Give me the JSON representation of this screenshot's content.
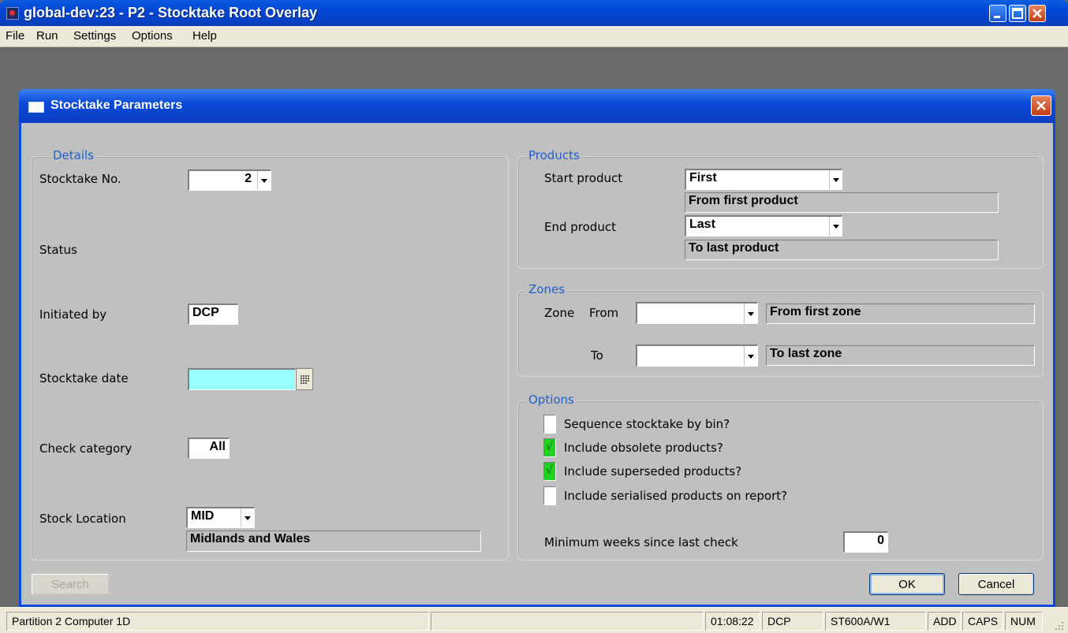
{
  "window": {
    "title": "global-dev:23 - P2 - Stocktake Root Overlay"
  },
  "menu": [
    "File",
    "Run",
    "Settings",
    "Options",
    "Help"
  ],
  "dialog": {
    "title": "Stocktake Parameters"
  },
  "details": {
    "group_title": "Details",
    "stocktake_no_label": "Stocktake No.",
    "stocktake_no_value": "2",
    "status_label": "Status",
    "initiated_by_label": "Initiated by",
    "initiated_by_value": "DCP",
    "stocktake_date_label": "Stocktake date",
    "stocktake_date_value": "",
    "check_category_label": "Check category",
    "check_category_value": "All",
    "stock_location_label": "Stock Location",
    "stock_location_value": "MID",
    "stock_location_desc": "Midlands and Wales"
  },
  "products": {
    "group_title": "Products",
    "start_label": "Start product",
    "start_value": "First",
    "start_desc": "From first product",
    "end_label": "End product",
    "end_value": "Last",
    "end_desc": "To last product"
  },
  "zones": {
    "group_title": "Zones",
    "zone_label": "Zone",
    "from_label": "From",
    "from_value": "",
    "from_desc": "From first zone",
    "to_label": "To",
    "to_value": "",
    "to_desc": "To last zone"
  },
  "options": {
    "group_title": "Options",
    "items": [
      {
        "label": "Sequence stocktake by bin?",
        "checked": false
      },
      {
        "label": "Include obsolete products?",
        "checked": true
      },
      {
        "label": "Include superseded products?",
        "checked": true
      },
      {
        "label": "Include serialised products on report?",
        "checked": false
      }
    ],
    "min_weeks_label": "Minimum weeks since last check",
    "min_weeks_value": "0"
  },
  "buttons": {
    "search": "Search",
    "ok": "OK",
    "cancel": "Cancel"
  },
  "status": {
    "left": "Partition 2 Computer 1D",
    "time": "01:08:22",
    "user": "DCP",
    "program": "ST600A/W1",
    "add": "ADD",
    "caps": "CAPS",
    "num": "NUM"
  },
  "colors": {
    "accent": "#0a4ad8",
    "group_title": "#1f5fd0",
    "date_field": "#99ffff",
    "checked": "#22d022"
  }
}
